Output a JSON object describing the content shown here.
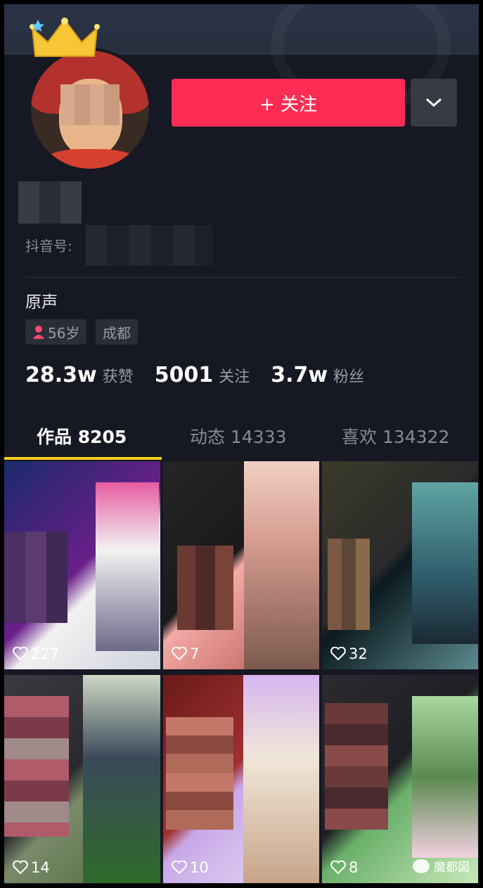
{
  "header": {
    "follow_label": "+ 关注"
  },
  "profile": {
    "id_label": "抖音号:",
    "bio": "原声",
    "tags": {
      "age": "56岁",
      "city": "成都"
    }
  },
  "stats": [
    {
      "value": "28.3w",
      "label": "获赞"
    },
    {
      "value": "5001",
      "label": "关注"
    },
    {
      "value": "3.7w",
      "label": "粉丝"
    }
  ],
  "tabs": [
    {
      "label": "作品 8205"
    },
    {
      "label": "动态 14333"
    },
    {
      "label": "喜欢 134322"
    }
  ],
  "videos": [
    {
      "likes": "227"
    },
    {
      "likes": "7"
    },
    {
      "likes": "32"
    },
    {
      "likes": "14"
    },
    {
      "likes": "10"
    },
    {
      "likes": "8"
    }
  ],
  "watermark": "魔都図",
  "colors": {
    "accent": "#fe2c55",
    "tab_indicator": "#face15",
    "background": "#161823"
  }
}
